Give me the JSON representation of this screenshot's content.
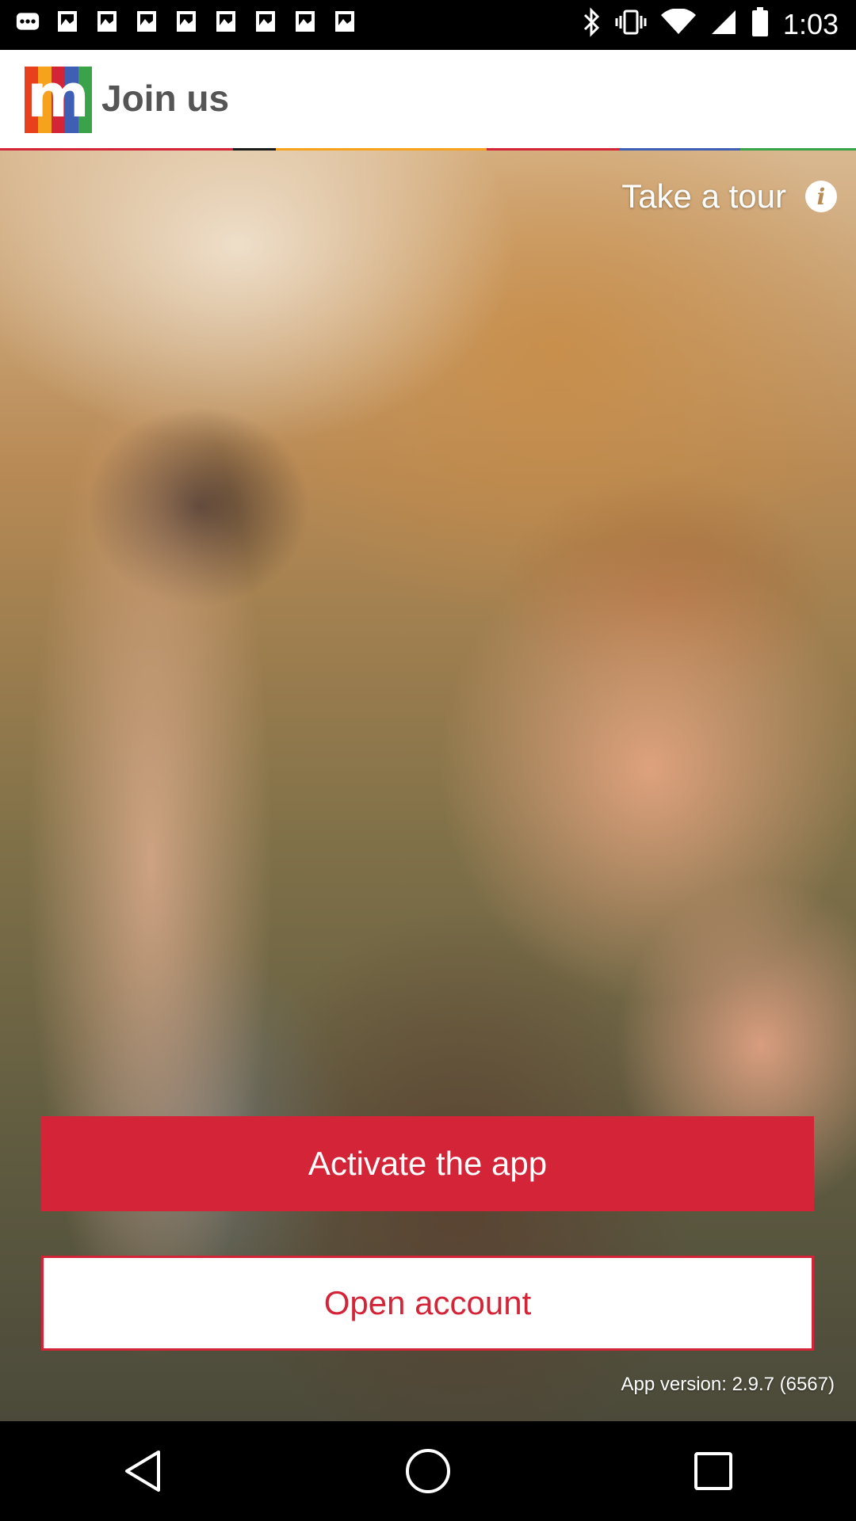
{
  "status_bar": {
    "time": "1:03",
    "notification_icons": [
      "message-icon",
      "photo-icon",
      "photo-icon",
      "photo-icon",
      "photo-icon",
      "photo-icon",
      "photo-icon",
      "photo-icon",
      "photo-icon"
    ],
    "status_icons": [
      "bluetooth-icon",
      "vibrate-icon",
      "wifi-icon",
      "signal-icon",
      "battery-icon"
    ]
  },
  "app_bar": {
    "logo_letter": "m",
    "logo_colors": [
      "#e8401c",
      "#f6a21d",
      "#d42437",
      "#3f5fb5",
      "#3aa34a"
    ],
    "title": "Join us",
    "accent_colors": [
      "#d42437",
      "#1a1a1a",
      "#f6a21d",
      "#d42437",
      "#3f5fb5",
      "#3aa34a"
    ]
  },
  "hero": {
    "tour_label": "Take a tour",
    "info_icon_glyph": "i",
    "activate_button": "Activate the app",
    "open_account_button": "Open account",
    "version_text": "App version: 2.9.7 (6567)"
  },
  "nav_bar": {
    "icons": [
      "back-icon",
      "home-icon",
      "recents-icon"
    ]
  },
  "colors": {
    "brand_red": "#d42437",
    "app_bar_bg": "#ffffff",
    "title_text": "#555555"
  }
}
